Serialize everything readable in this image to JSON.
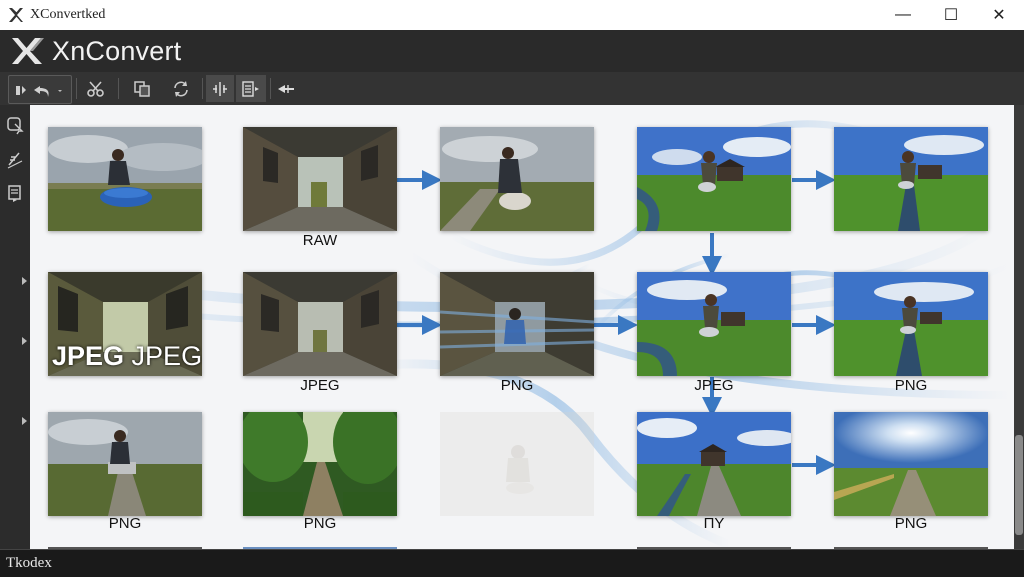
{
  "window": {
    "title": "XConvertked",
    "minimize_glyph": "—",
    "maximize_glyph": "☐",
    "close_glyph": "✕"
  },
  "app": {
    "brand": "XnConvert",
    "logo_icon": "xn-logo-icon"
  },
  "toolbar": {
    "buttons": [
      {
        "name": "undo-group",
        "icon": "undo-icon"
      },
      {
        "name": "cut",
        "icon": "scissors-icon"
      },
      {
        "name": "copy",
        "icon": "copy-icon"
      },
      {
        "name": "rotate",
        "icon": "rotate-icon"
      },
      {
        "name": "compare",
        "icon": "compare-icon"
      },
      {
        "name": "list",
        "icon": "list-icon"
      },
      {
        "name": "flip",
        "icon": "flip-icon"
      }
    ]
  },
  "sidebar": {
    "icons": [
      "pointer-icon",
      "pen-icon",
      "document-icon"
    ]
  },
  "grid": {
    "row1": {
      "c2": "RAW"
    },
    "row2": {
      "overlay_bold": "JPEG",
      "overlay_regular": " JPEG",
      "c2": "JPEG",
      "c3": "PNG",
      "c4": "JPEG",
      "c5": "PNG"
    },
    "row3": {
      "c1": "PNG",
      "c2": "PNG",
      "c4": "ПY",
      "c5": "PNG"
    }
  },
  "colors": {
    "arrow": "#3a78c2",
    "content_bg": "#f4f5f7",
    "dark_bar": "#2a2a2a"
  },
  "status": {
    "text": "Tkodex"
  }
}
